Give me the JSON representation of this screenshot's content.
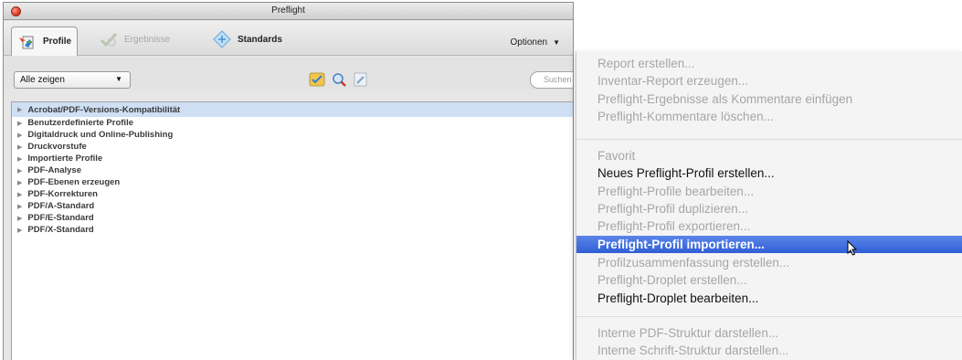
{
  "window": {
    "title": "Preflight"
  },
  "tabs": [
    {
      "label": "Profile",
      "state": "active",
      "icon": "profile-icon"
    },
    {
      "label": "Ergebnisse",
      "state": "disabled",
      "icon": "results-icon"
    },
    {
      "label": "Standards",
      "state": "normal",
      "icon": "standards-icon"
    }
  ],
  "options": {
    "label": "Optionen"
  },
  "filter": {
    "selected": "Alle zeigen"
  },
  "search": {
    "placeholder": "Suchen"
  },
  "list_items": [
    "Acrobat/PDF-Versions-Kompatibilität",
    "Benutzerdefinierte Profile",
    "Digitaldruck und Online-Publishing",
    "Druckvorstufe",
    "Importierte Profile",
    "PDF-Analyse",
    "PDF-Ebenen erzeugen",
    "PDF-Korrekturen",
    "PDF/A-Standard",
    "PDF/E-Standard",
    "PDF/X-Standard"
  ],
  "menu": {
    "group1": [
      "Report erstellen...",
      "Inventar-Report erzeugen...",
      "Preflight-Ergebnisse als Kommentare einfügen",
      "Preflight-Kommentare löschen..."
    ],
    "group2": [
      "Favorit",
      "Neues Preflight-Profil erstellen...",
      "Preflight-Profile bearbeiten...",
      "Preflight-Profil duplizieren...",
      "Preflight-Profil exportieren...",
      "Preflight-Profil importieren...",
      "Profilzusammenfassung erstellen...",
      "Preflight-Droplet erstellen...",
      "Preflight-Droplet bearbeiten..."
    ],
    "group3": [
      "Interne PDF-Struktur darstellen...",
      "Interne Schrift-Struktur darstellen..."
    ]
  },
  "colors": {
    "highlight": "#2f5fd6",
    "selection": "#cfe0f5"
  }
}
